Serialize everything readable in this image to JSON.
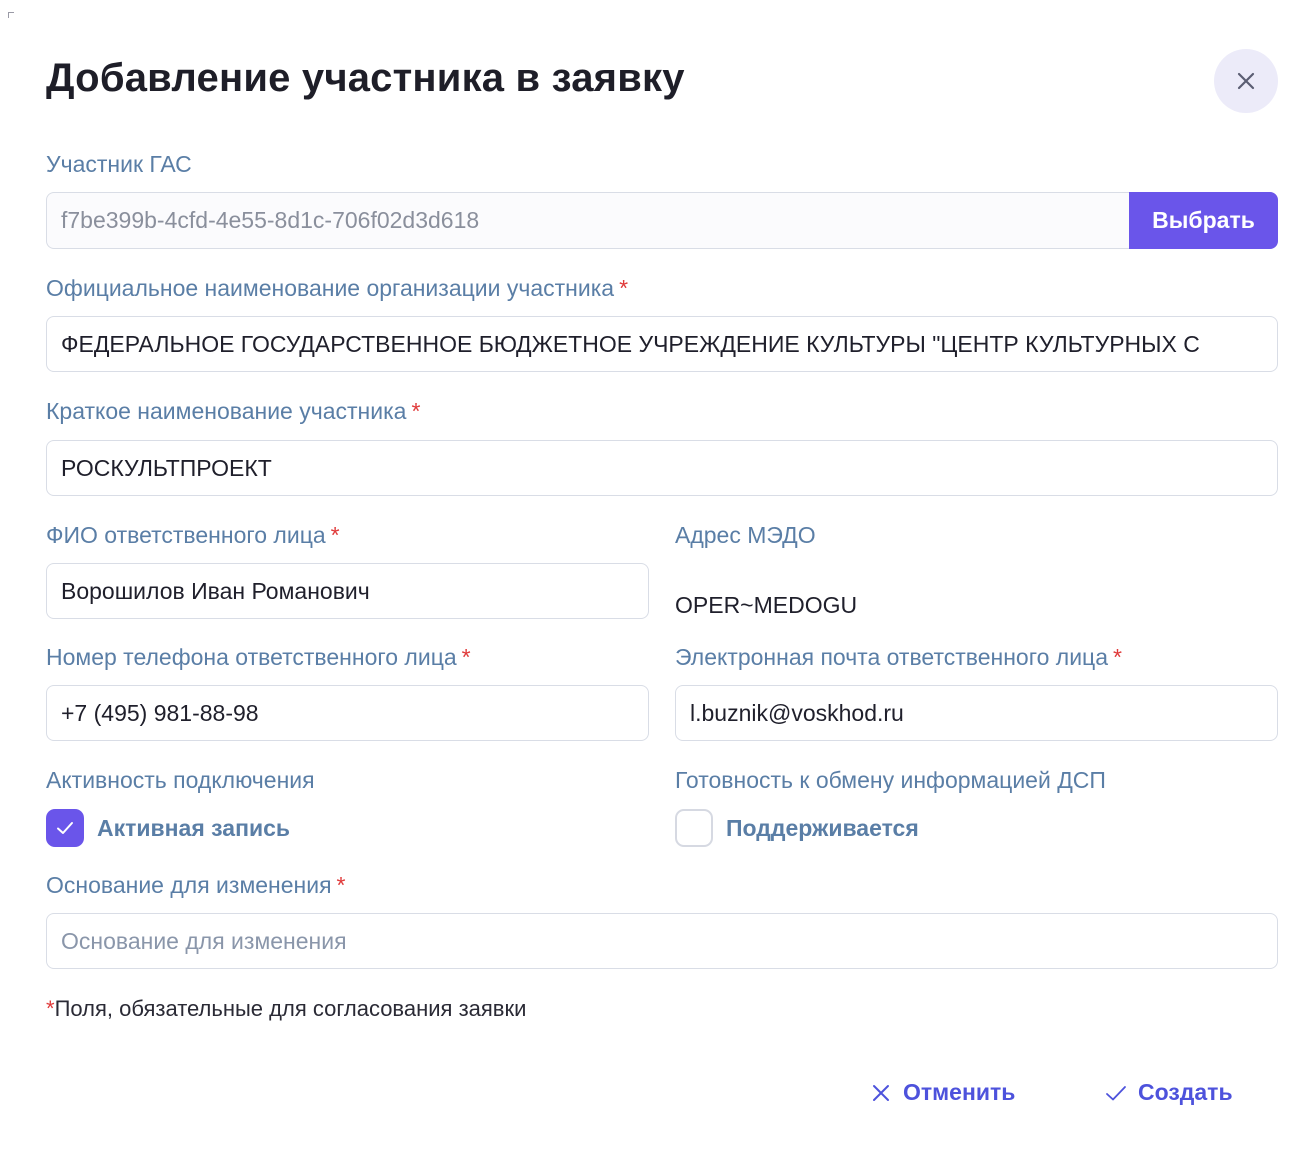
{
  "dialog": {
    "title": "Добавление участника в заявку"
  },
  "gas_participant": {
    "label": "Участник ГАС",
    "value": "f7be399b-4cfd-4e55-8d1c-706f02d3d618",
    "choose_label": "Выбрать"
  },
  "official_name": {
    "label": "Официальное наименование организации участника",
    "value": "ФЕДЕРАЛЬНОЕ ГОСУДАРСТВЕННОЕ БЮДЖЕТНОЕ УЧРЕЖДЕНИЕ КУЛЬТУРЫ \"ЦЕНТР КУЛЬТУРНЫХ С"
  },
  "short_name": {
    "label": "Краткое наименование участника",
    "value": "РОСКУЛЬТПРОЕКТ"
  },
  "responsible_person": {
    "label": "ФИО ответственного лица",
    "value": "Ворошилов Иван Романович"
  },
  "medo_address": {
    "label": "Адрес МЭДО",
    "value": "OPER~MEDOGU"
  },
  "phone": {
    "label": "Номер телефона ответственного лица",
    "value": "+7 (495) 981-88-98"
  },
  "email": {
    "label": "Электронная почта ответственного лица",
    "value": "l.buznik@voskhod.ru"
  },
  "connection_activity": {
    "label": "Активность подключения",
    "checkbox_label": "Активная запись",
    "checked": true
  },
  "dsp_readiness": {
    "label": "Готовность к обмену информацией ДСП",
    "checkbox_label": "Поддерживается",
    "checked": false
  },
  "change_reason": {
    "label": "Основание для изменения",
    "placeholder": "Основание для изменения",
    "value": ""
  },
  "required_mark": "*",
  "required_note": "Поля, обязательные для согласования заявки",
  "actions": {
    "cancel_label": "Отменить",
    "create_label": "Создать"
  },
  "colors": {
    "accent": "#6a55ea",
    "label": "#5a7ea6",
    "required": "#e03a3a",
    "action": "#4d52dc"
  }
}
